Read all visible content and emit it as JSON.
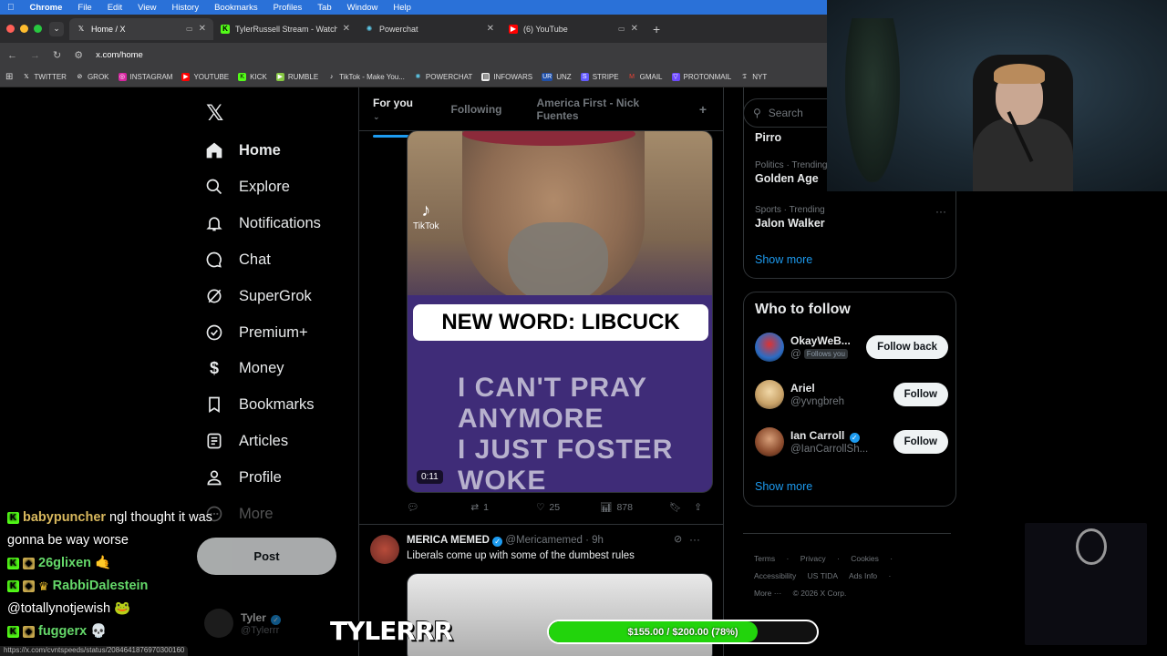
{
  "menubar": {
    "app": "Chrome",
    "items": [
      "File",
      "Edit",
      "View",
      "History",
      "Bookmarks",
      "Profiles",
      "Tab",
      "Window",
      "Help"
    ]
  },
  "browser": {
    "tabs": [
      {
        "title": "Home / X",
        "icon": "x-logo"
      },
      {
        "title": "TylerRussell Stream - Watch",
        "icon": "kick-logo"
      },
      {
        "title": "Powerchat",
        "icon": "powerchat-logo"
      },
      {
        "title": "(6) YouTube",
        "icon": "youtube-logo"
      }
    ],
    "url": "x.com/home",
    "bookmarks": [
      "TWITTER",
      "GROK",
      "INSTAGRAM",
      "YOUTUBE",
      "KICK",
      "RUMBLE",
      "TikTok - Make You...",
      "POWERCHAT",
      "INFOWARS",
      "UNZ",
      "STRIPE",
      "GMAIL",
      "PROTONMAIL",
      "NYT"
    ]
  },
  "sidebar": {
    "items": [
      {
        "label": "Home",
        "icon": "home-icon"
      },
      {
        "label": "Explore",
        "icon": "search-icon"
      },
      {
        "label": "Notifications",
        "icon": "bell-icon"
      },
      {
        "label": "Chat",
        "icon": "chat-icon"
      },
      {
        "label": "SuperGrok",
        "icon": "grok-icon"
      },
      {
        "label": "Premium+",
        "icon": "verified-icon"
      },
      {
        "label": "Money",
        "icon": "money-icon"
      },
      {
        "label": "Bookmarks",
        "icon": "bookmark-icon"
      },
      {
        "label": "Articles",
        "icon": "article-icon"
      },
      {
        "label": "Profile",
        "icon": "person-icon"
      },
      {
        "label": "More",
        "icon": "more-icon"
      }
    ],
    "post_label": "Post",
    "account": {
      "name": "Tyler",
      "handle": "@Tylerrr"
    }
  },
  "timeline": {
    "tabs": [
      "For you",
      "Following",
      "America First - Nick Fuentes"
    ],
    "video": {
      "caption": "NEW WORD: LIBCUCK",
      "duration": "0:11",
      "watermark": "TikTok",
      "shirt_text": "I CAN'T PRAY ANYMORE / I JUST FOSTER WOKE / TILL THEY FIND THE / FOREVER HOME"
    },
    "actions": {
      "replies": "",
      "reposts": "1",
      "likes": "25",
      "views": "878"
    },
    "post2": {
      "name": "MERICA MEMED",
      "handle": "@Mericamemed",
      "time": "9h",
      "text": "Liberals come up with some of the dumbest rules"
    }
  },
  "right": {
    "search_placeholder": "Search",
    "trends": [
      {
        "category": "",
        "topic": "Pirro"
      },
      {
        "category": "Politics · Trending",
        "topic": "Golden Age"
      },
      {
        "category": "Sports · Trending",
        "topic": "Jalon Walker"
      }
    ],
    "show_more": "Show more",
    "who_to_follow": {
      "title": "Who to follow",
      "users": [
        {
          "name": "OkayWeB...",
          "handle": "@",
          "follows_you": "Follows you",
          "button": "Follow back",
          "verified": false
        },
        {
          "name": "Ariel",
          "handle": "@yvngbreh",
          "follows_you": "",
          "button": "Follow",
          "verified": false
        },
        {
          "name": "Ian Carroll",
          "handle": "@IanCarrollSh...",
          "follows_you": "",
          "button": "Follow",
          "verified": true
        }
      ],
      "show_more": "Show more"
    },
    "footer": [
      "Terms",
      "Privacy",
      "Cookies",
      "Accessibility",
      "US TIDA",
      "Ads Info",
      "More ···",
      "© 2026 X Corp."
    ]
  },
  "stream": {
    "streamer_name": "TYLERRR",
    "goal": {
      "label": "$155.00 / $200.00 (78%)",
      "progress": 0.78,
      "color": "#22d40c"
    },
    "chat": [
      {
        "user": "babypuncher",
        "message": "ngl thought it was"
      },
      {
        "user": "",
        "message": "gonna be way worse"
      },
      {
        "user": "26glixen",
        "message": "🤙"
      },
      {
        "user": "RabbiDalestein",
        "message": ""
      },
      {
        "user": "",
        "message": "@totallynotjewish 🐸"
      },
      {
        "user": "fuggerx",
        "message": "💀"
      }
    ]
  },
  "status_url": "https://x.com/cvntspeeds/status/2084641876970300160",
  "colors": {
    "accent": "#1d9bf0",
    "background": "#000000",
    "menubar": "#2a71d8"
  }
}
